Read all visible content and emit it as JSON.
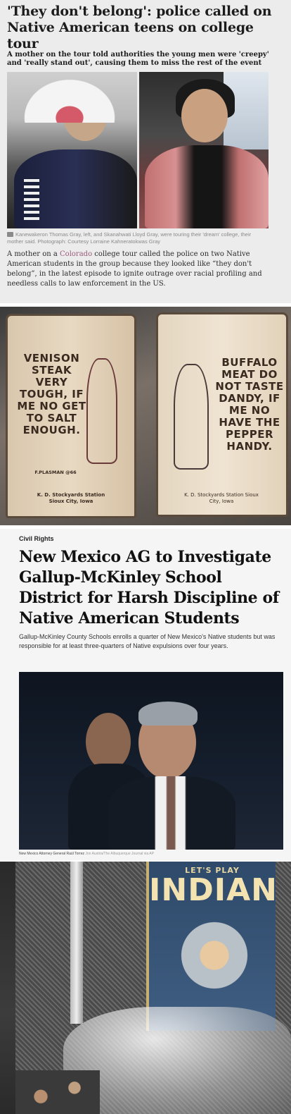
{
  "clip1": {
    "headline": "'They don't belong': police called on Native American teens on college tour",
    "standfirst": "A mother on the tour told authorities the young men were 'creepy' and 'really stand out', causing them to miss the rest of the event",
    "caption": "Kanewakeron Thomas Gray, left, and Skanahwati Lloyd Gray, were touring their 'dream' college, their mother said. Photograph: Courtesy Lorraine Kahneratokwas Gray",
    "body_before": "A mother on a ",
    "body_link": "Colorado",
    "body_after": " college tour called the police on two Native American students in the group because they looked like “they don't belong”, in the latest episode to ignite outrage over racial profiling and needless calls to law enforcement in the US."
  },
  "signs": {
    "left_sign": {
      "text": "VENISON STEAK VERY TOUGH, IF ME NO GET TO SALT ENOUGH.",
      "artist": "F.PLASMAN @66",
      "station": "K. D. Stockyards Station Sioux City, Iowa"
    },
    "right_sign": {
      "text": "BUFFALO MEAT DO NOT TASTE DANDY, IF ME NO HAVE THE PEPPER HANDY.",
      "station": "K. D. Stockyards Station Sioux City, Iowa"
    }
  },
  "clip3": {
    "kicker": "Civil Rights",
    "title": "New Mexico AG to Investigate Gallup-McKinley School District for Harsh Discipline of Native American Students",
    "dek": "Gallup-McKinley County Schools enrolls a quarter of New Mexico's Native students but was responsible for at least three-quarters of Native expulsions over four years.",
    "caption": "New Mexico Attorney General Raúl Torrez",
    "credit": "Jon Austria/The Albuquerque Journal via AP"
  },
  "clip4": {
    "book_sub": "LET'S PLAY",
    "book_title": "INDIAN"
  }
}
